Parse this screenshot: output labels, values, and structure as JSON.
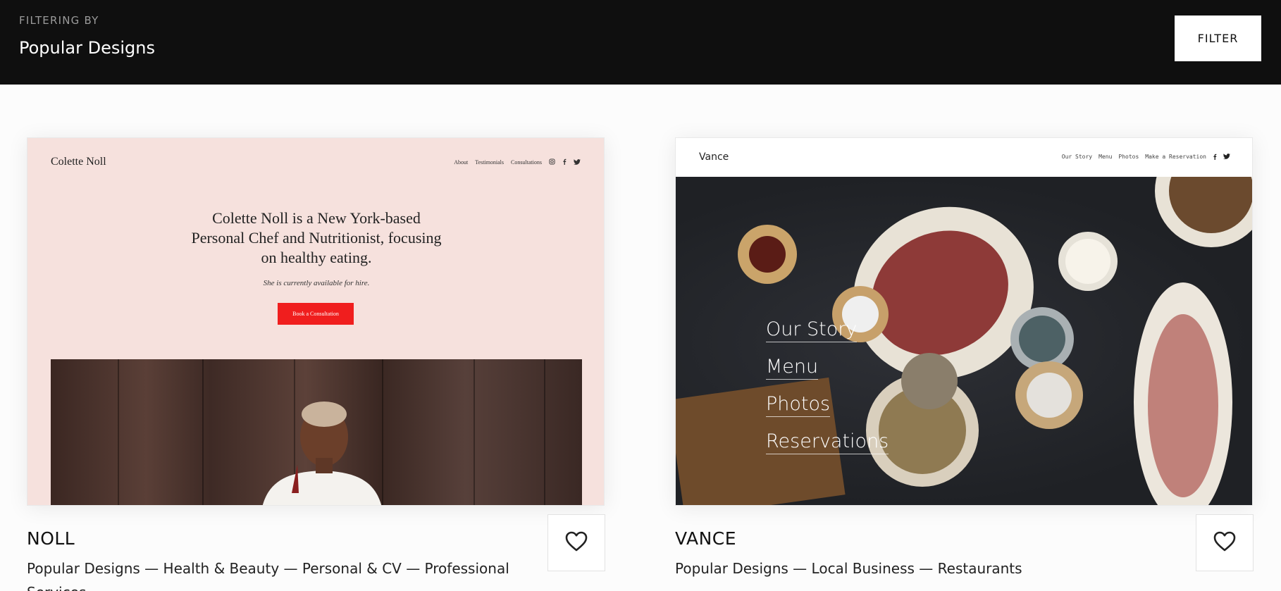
{
  "header": {
    "filter_label": "FILTERING BY",
    "filter_value": "Popular Designs",
    "filter_button": "FILTER"
  },
  "cards": [
    {
      "name": "NOLL",
      "tags": "Popular Designs  —  Health & Beauty  —  Personal & CV  —  Professional Services",
      "preview": {
        "brand": "Colette Noll",
        "nav": [
          "About",
          "Testimonials",
          "Consultations"
        ],
        "headline_lines": [
          "Colette Noll is a New York-based",
          "Personal Chef and Nutritionist, focusing",
          "on healthy eating."
        ],
        "subline": "She is currently available for hire.",
        "cta": "Book a Consultation"
      }
    },
    {
      "name": "VANCE",
      "tags": "Popular Designs  —  Local Business  —  Restaurants",
      "preview": {
        "brand": "Vance",
        "nav": [
          "Our Story",
          "Menu",
          "Photos",
          "Make a Reservation"
        ],
        "menu": [
          "Our Story",
          "Menu",
          "Photos",
          "Reservations"
        ]
      }
    }
  ],
  "icons": {
    "favorite": "heart-icon",
    "instagram": "instagram-icon",
    "facebook": "facebook-icon",
    "twitter": "twitter-icon"
  },
  "colors": {
    "header_bg": "#0f0f0f",
    "noll_bg": "#f6e1dd",
    "noll_cta": "#f01e1e",
    "vance_bg": "#23252a"
  }
}
